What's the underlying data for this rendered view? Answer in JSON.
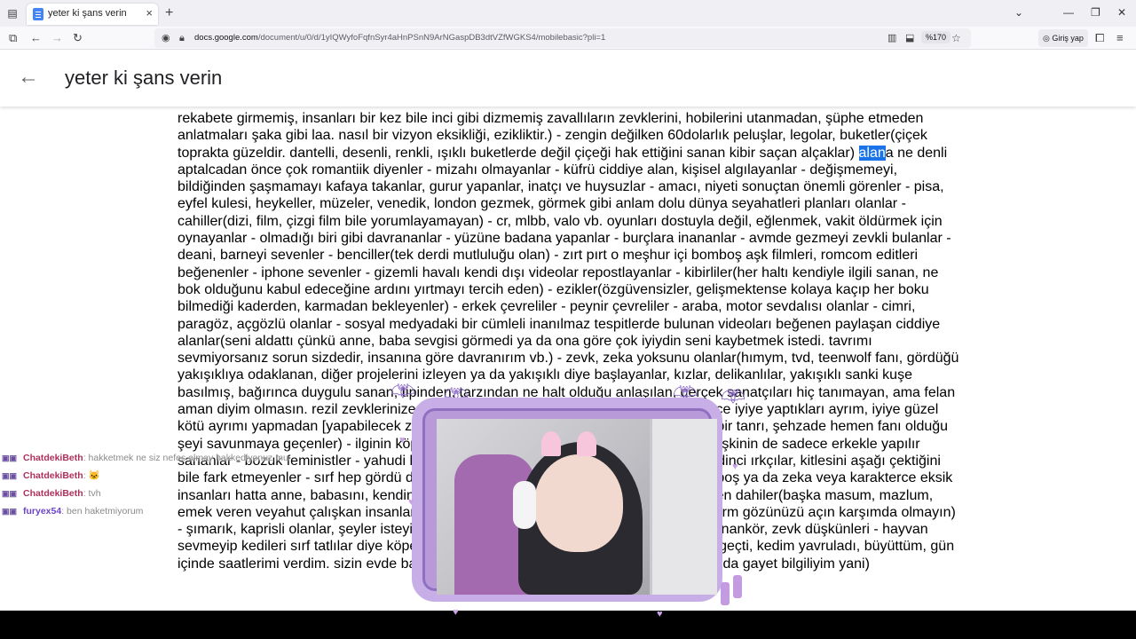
{
  "browser": {
    "tab_title": "yeter ki şans verin",
    "url_host": "docs.google.com",
    "url_path": "/document/u/0/d/1yIQWyfoFqfnSyr4aHnPSnN9ArNGaspDB3dtVZfWGKS4/mobilebasic?pli=1",
    "zoom": "%170",
    "signin_label": "Giriş yap"
  },
  "docs": {
    "title": "yeter ki şans verin",
    "text_before_selection": "rekabete girmemiş, insanları bir kez bile inci gibi dizmemiş zavallıların zevklerini, hobilerini utanmadan, şüphe etmeden anlatmaları şaka gibi laa. nasıl bir vizyon eksikliği, ezikliktir.) - zengin değilken 60dolarlık peluşlar, legolar, buketler(çiçek toprakta güzeldir. dantelli, desenli, renkli, ışıklı buketlerde değil çiçeği hak ettiğini sanan kibir saçan alçaklar) ",
    "selected_text": "alan",
    "text_after_selection": "a ne denli aptalcadan önce çok romantiik diyenler - mizahı olmayanlar - küfrü ciddiye alan, kişisel algılayanlar - değişmemeyi, bildiğinden şaşmamayı kafaya takanlar, gurur yapanlar, inatçı ve huysuzlar - amacı, niyeti sonuçtan önemli görenler - pisa, eyfel kulesi, heykeller, müzeler, venedik, london gezmek, görmek gibi anlam dolu dünya seyahatleri planları olanlar - cahiller(dizi, film, çizgi film bile yorumlayamayan) - cr, mlbb, valo vb. oyunları dostuyla değil, eğlenmek, vakit öldürmek için oynayanlar - olmadığı biri gibi davrananlar - yüzüne badana yapanlar - burçlara inananlar - avmde gezmeyi zevkli bulanlar - deani, barneyi sevenler - benciller(tek derdi mutluluğu olan) - zırt pırt o meşhur içi bomboş aşk filmleri, romcom editleri beğenenler - iphone sevenler - gizemli havalı kendi dışı videolar repostlayanlar - kibirliler(her haltı kendiyle ilgili sanan, ne bok olduğunu kabul edeceğine ardını yırtmayı tercih eden) - ezikler(özgüvensizler, gelişmektense kolaya kaçıp her boku bilmediği kaderden, karmadan bekleyenler) - erkek çevreliler - peynir çevreliler - araba, motor sevdalısı olanlar - cimri, paragöz, açgözlü olanlar - sosyal medyadaki bir cümleli inanılmaz tespitlerde bulunan videoları beğenen paylaşan ciddiye alanlar(seni aldattı çünkü anne, baba sevgisi görmedi ya da ona göre çok iyiydin seni kaybetmek istedi. tavrımı sevmiyorsanız sorun sizdedir, insanına göre davranırım vb.) - zevk, zeka yoksunu olanlar(hımym, tvd, teenwolf fanı, gördüğü yakışıklıya odaklanan, diğer projelerini izleyen ya da yakışıklı diye başlayanlar, kızlar, delikanlılar, yakışıklı sanki kuşe basılmış, bağırınca duygulu sanan, tipinden, tarzından ne halt olduğu anlaşılan, gerçek sanatçıları hiç tanımayan, ama felan aman diyim olmasın. rezil zevklerinize tabiki en içlerimden saygı duyuyorum ben sadece iyiye yaptıkları ayrım, iyiye güzel kötü ayrımı yapmadan [yapabilecek zekaları da yok gerçi] her şeyi iyi gören ve bunun bir tanrı, şehzade hemen fanı olduğu şeyi savunmaya geçenler) - ilginin köpeğine dönenler, şeytan diyenler, en büyük şey, ilişkinin de sadece erkekle yapılır sananlar - bozuk feministler - yahudi kuklası olanlar, cahil milliyetçiler, ırkçılar, bağnaz dinci ırkçılar, kitlesini aşağı çektiğini bile fark etmeyenler - sırf hep gördü diye beğenenler, yakışıklı, kaslı ve fit ama içi bomboş ya da zeka veya karakterce eksik insanları hatta anne, babasını, kendini, değersiz gerçekten değerli kişileri değerde gören dahiler(başka masum, mazlum, emek veren veyahut çalışkan insanları görmeyen, potansiyeli varsa size iyi olmasını skrm gözünüzü açın karşımda olmayın) - şımarık, kaprisli olanlar, şeyler isteyip, editlerini beğenen destek verenler) - mimiksiz, nankör, zevk düşkünleri - hayvan sevmeyip kedileri sırf tatlılar diye köpeğe tercih edenler(tüm çocukluğum kedi peşinde geçti, kedim yavruladı, büyüttüm, gün içinde saatlerimi verdim. sizin evde bakıp düşük zekanıza tanımladığınız kediler hakkında gayet bilgiliyim yani)"
  },
  "chat": [
    {
      "user": "ChatdekiBeth",
      "text": ": hakketmek ne siz nefes almay hakkediyonuz mu"
    },
    {
      "user": "ChatdekiBeth",
      "text": ": 🐱"
    },
    {
      "user": "ChatdekiBeth",
      "text": ": tvh"
    },
    {
      "user": "furyex54",
      "text": ": ben haketmiyorum"
    }
  ],
  "colors": {
    "selection": "#1a73e8",
    "chat_user": "#b0305b",
    "chat_user_alt": "#6b44c9",
    "webcam_frame": "#c7aee6"
  }
}
